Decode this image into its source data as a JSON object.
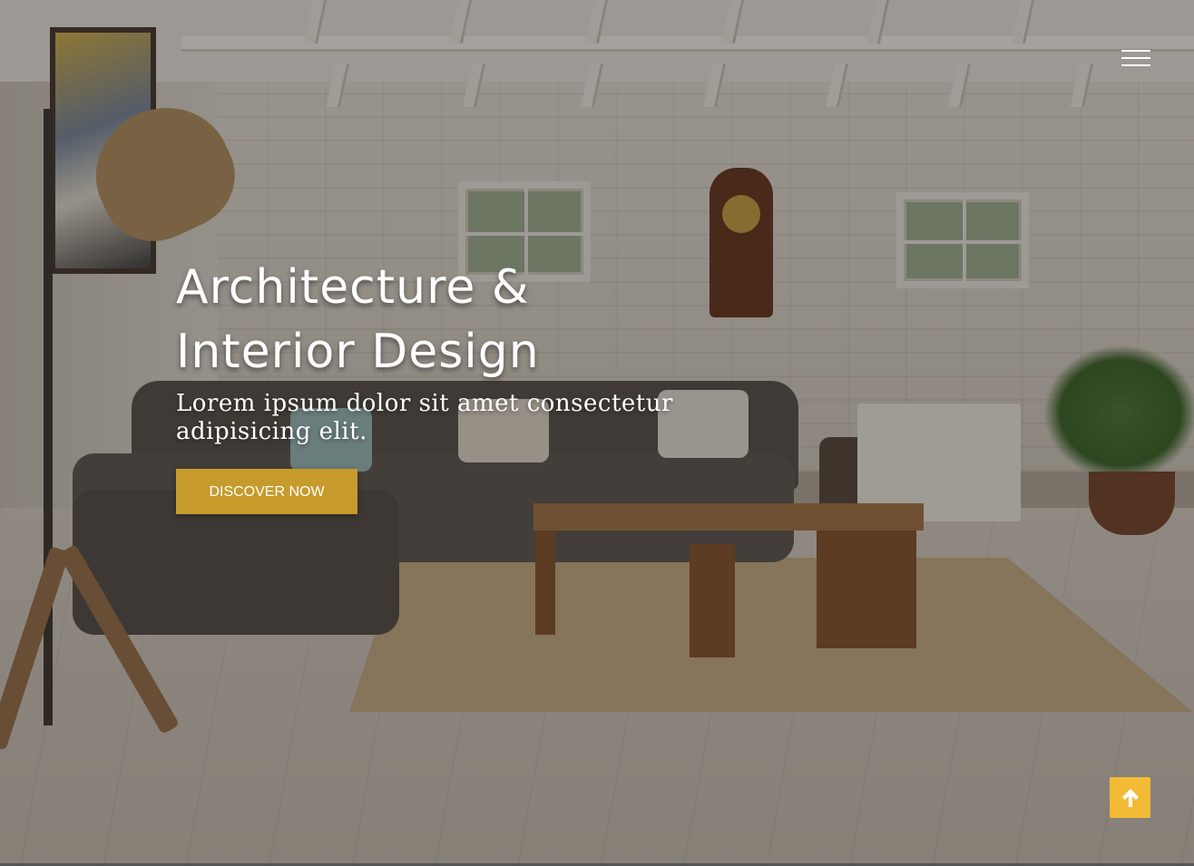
{
  "header": {
    "menu_icon": "hamburger-menu-icon"
  },
  "hero": {
    "title_line1": "Architecture &",
    "title_line2": "Interior Design",
    "subtitle": "Lorem ipsum dolor sit amet consectetur adipisicing elit.",
    "cta_label": "DISCOVER NOW"
  },
  "scroll_top": {
    "icon": "arrow-up-icon"
  },
  "colors": {
    "accent": "#c79a2c",
    "scroll_button": "#f3bb35",
    "text": "#ffffff"
  }
}
